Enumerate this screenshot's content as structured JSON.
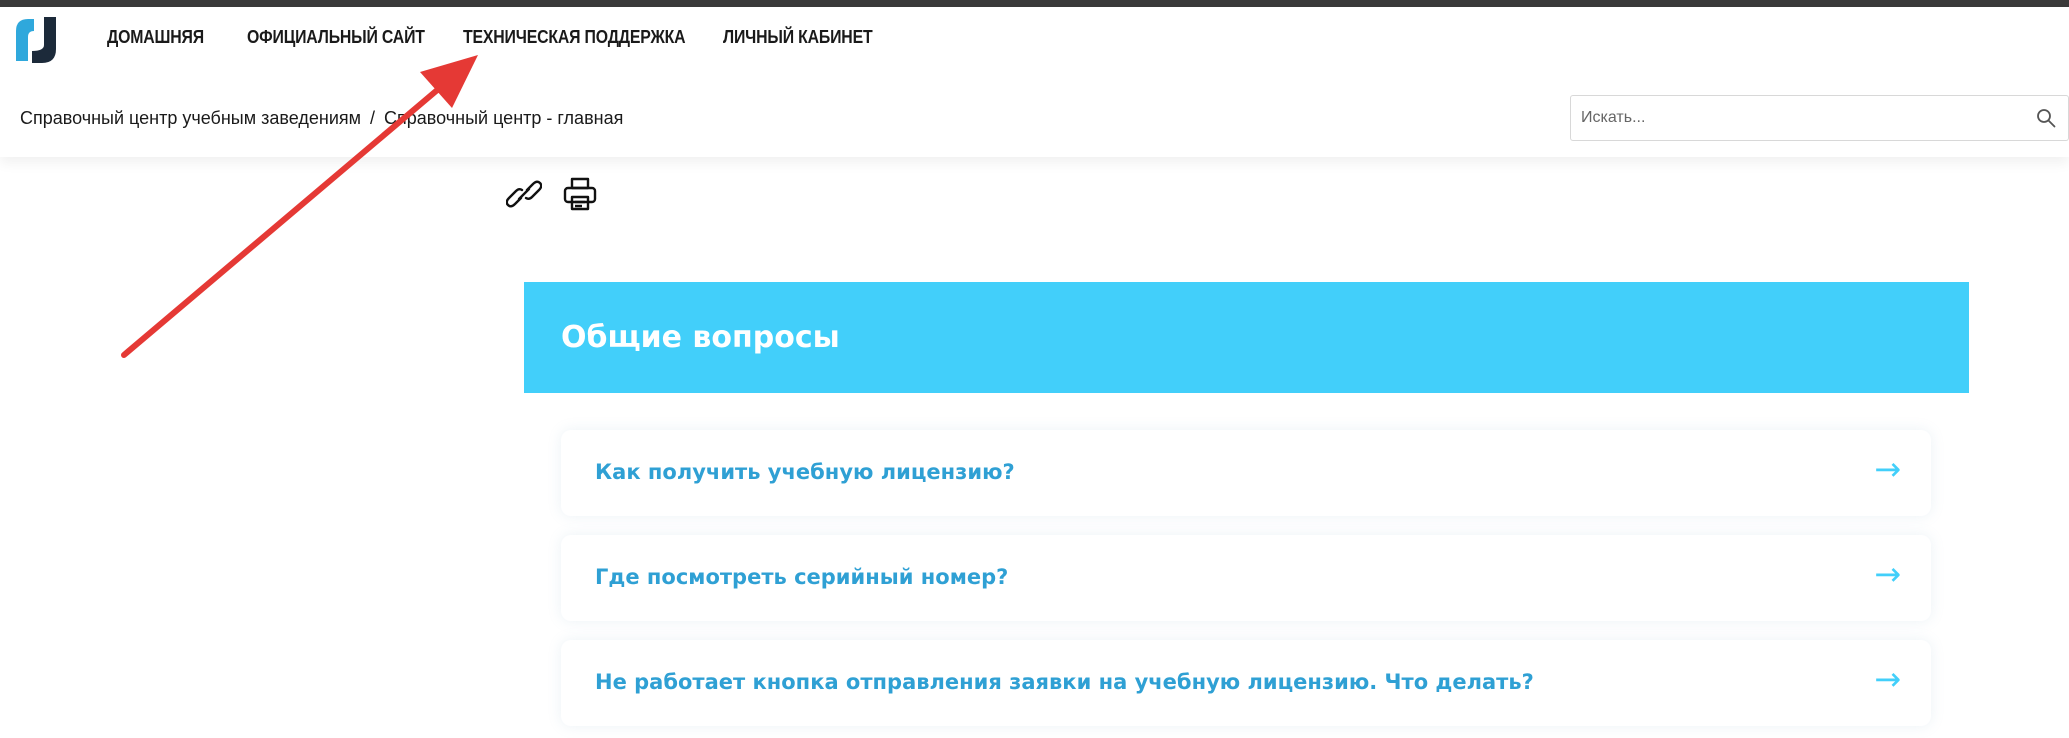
{
  "nav": {
    "items": [
      {
        "label": "Домашняя"
      },
      {
        "label": "Официальный сайт"
      },
      {
        "label": "Техническая поддержка"
      },
      {
        "label": "Личный кабинет"
      }
    ]
  },
  "breadcrumb": {
    "items": [
      {
        "label": "Справочный центр учебным заведениям"
      },
      {
        "label": "Справочный центр - главная"
      }
    ],
    "separator": "/"
  },
  "search": {
    "placeholder": "Искать...",
    "value": ""
  },
  "section": {
    "title": "Общие вопросы"
  },
  "faq": [
    {
      "question": "Как получить учебную лицензию?",
      "arrow": "→"
    },
    {
      "question": "Где посмотреть серийный номер?",
      "arrow": "→"
    },
    {
      "question": "Не работает кнопка отправления заявки на учебную лицензию. Что делать?",
      "arrow": "→"
    }
  ],
  "icons": {
    "logo": "brand-logo",
    "link": "link-icon",
    "print": "print-icon",
    "search": "search-icon",
    "annotation": "red-arrow-annotation"
  },
  "colors": {
    "accent": "#42cffa",
    "faq_text": "#2fa0d4",
    "logo_dark": "#1c2a3a",
    "annotation": "#e53935"
  }
}
